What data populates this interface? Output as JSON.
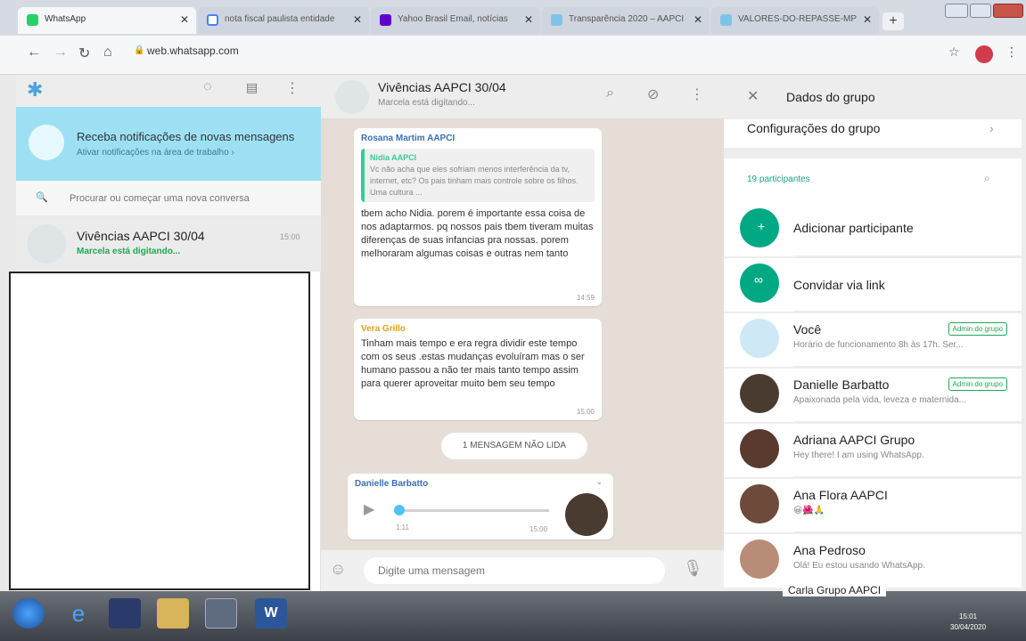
{
  "browser": {
    "tabs": [
      {
        "title": "WhatsApp",
        "active": true,
        "favicon_color": "#25d366"
      },
      {
        "title": "nota fiscal paulista entidade",
        "active": false,
        "favicon_color": "#4285f4"
      },
      {
        "title": "Yahoo Brasil Email, notícias",
        "active": false,
        "favicon_color": "#6001d2"
      },
      {
        "title": "Transparência 2020 – AAPCI",
        "active": false,
        "favicon_color": "#7fc4e8"
      },
      {
        "title": "VALORES-DO-REPASSE-MP",
        "active": false,
        "favicon_color": "#7fc4e8"
      }
    ],
    "new_tab": "+",
    "url": "web.whatsapp.com"
  },
  "left": {
    "notification": {
      "title": "Receba notificações de novas mensagens",
      "subtitle": "Ativar notificações na área de trabalho ›"
    },
    "search_placeholder": "Procurar ou começar uma nova conversa",
    "chat": {
      "name": "Vivências AAPCI 30/04",
      "status": "Marcela está digitando...",
      "time": "15:00"
    }
  },
  "chat": {
    "header_title": "Vivências AAPCI 30/04",
    "header_status": "Marcela está digitando...",
    "messages": [
      {
        "sender": "Rosana Martim AAPCI",
        "quote_author": "Nidia AAPCI",
        "quote_text": "Vc não acha que eles sofriam menos interferência da tv, internet, etc? Os pais tinham mais controle sobre os filhos. Uma cultura ...",
        "text": "tbem acho Nidia. porem é importante essa coisa de nos adaptarmos. pq nossos pais tbem tiveram muitas diferenças de suas infancias pra nossas. porem melhoraram algumas coisas e outras nem tanto",
        "time": "14:59"
      },
      {
        "sender": "Vera Grillo",
        "text": "Tinham mais tempo e era regra dividir este tempo com os seus .estas mudanças evoluíram mas o ser humano passou a não ter mais tanto tempo assim para querer aproveitar muito bem seu tempo",
        "time": "15:00"
      }
    ],
    "unread_label": "1 MENSAGEM NÃO LIDA",
    "voice": {
      "sender": "Danielle Barbatto",
      "duration": "1:11",
      "time": "15:00"
    },
    "input_placeholder": "Digite uma mensagem"
  },
  "right": {
    "title": "Dados do grupo",
    "settings_label": "Configurações do grupo",
    "participants_count": "19 participantes",
    "add_label": "Adicionar participante",
    "invite_label": "Convidar via link",
    "participants": [
      {
        "name": "Você",
        "status": "Horário de funcionamento 8h às 17h. Ser...",
        "badge": "Admin do grupo",
        "avatar_color": "#cfe8f5"
      },
      {
        "name": "Danielle Barbatto",
        "status": "Apaixonada pela vida, leveza e maternida...",
        "badge": "Admin do grupo",
        "avatar_color": "#4a3b30"
      },
      {
        "name": "Adriana AAPCI Grupo",
        "status": "Hey there! I am using WhatsApp.",
        "badge": "",
        "avatar_color": "#5a3a2e"
      },
      {
        "name": "Ana Flora AAPCI",
        "status": "😀🌺🙏",
        "badge": "",
        "avatar_color": "#6d4a3a"
      },
      {
        "name": "Ana Pedroso",
        "status": "Olá! Eu estou usando WhatsApp.",
        "badge": "",
        "avatar_color": "#b98c78"
      }
    ],
    "partial_name": "Carla Grupo AAPCI"
  },
  "taskbar": {
    "clock_time": "15:01",
    "clock_date": "30/04/2020"
  },
  "colors": {
    "accent": "#00bfa5",
    "notif_bg": "#9de0f4",
    "chat_bg": "#e6ded6",
    "teal_button": "#00a884"
  }
}
